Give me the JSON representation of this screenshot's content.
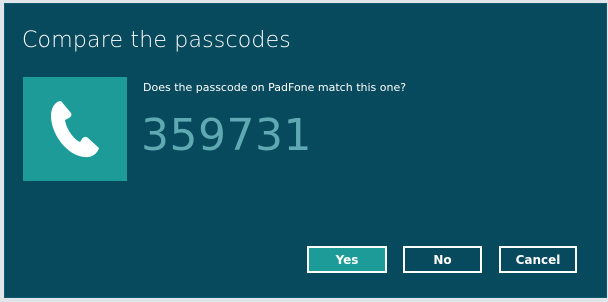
{
  "dialog": {
    "title": "Compare the passcodes",
    "icon": "phone-icon",
    "question": "Does the passcode on PadFone match this one?",
    "passcode": "359731",
    "buttons": {
      "yes": "Yes",
      "no": "No",
      "cancel": "Cancel"
    },
    "colors": {
      "background": "#084a5d",
      "accent": "#1c9b98",
      "passcode": "#5fa9b3"
    }
  }
}
